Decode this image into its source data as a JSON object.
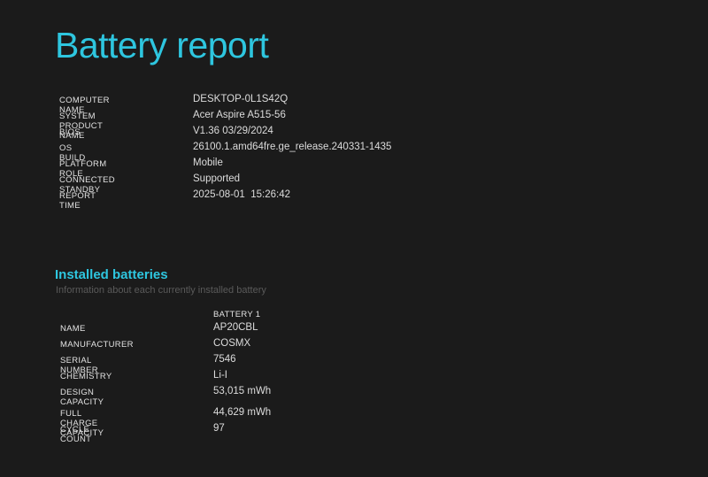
{
  "report": {
    "title": "Battery report"
  },
  "system_info": [
    {
      "label": "COMPUTER NAME",
      "value": "DESKTOP-0L1S42Q"
    },
    {
      "label": "SYSTEM PRODUCT NAME",
      "value": "Acer Aspire A515-56"
    },
    {
      "label": "BIOS",
      "value": "V1.36 03/29/2024"
    },
    {
      "label": "OS BUILD",
      "value": "26100.1.amd64fre.ge_release.240331-1435"
    },
    {
      "label": "PLATFORM ROLE",
      "value": "Mobile"
    },
    {
      "label": "CONNECTED STANDBY",
      "value": "Supported"
    },
    {
      "label": "REPORT TIME",
      "value": "2025-08-01  15:26:42"
    }
  ],
  "installed_batteries": {
    "title": "Installed batteries",
    "subtitle": "Information about each currently installed battery",
    "column_header": "BATTERY 1",
    "rows": [
      {
        "label": "NAME",
        "value": "AP20CBL"
      },
      {
        "label": "MANUFACTURER",
        "value": "COSMX"
      },
      {
        "label": "SERIAL NUMBER",
        "value": "7546"
      },
      {
        "label": "CHEMISTRY",
        "value": "Li-I"
      },
      {
        "label": "DESIGN CAPACITY",
        "value": "53,015 mWh"
      },
      {
        "label": "FULL CHARGE CAPACITY",
        "value": "44,629 mWh"
      },
      {
        "label": "CYCLE COUNT",
        "value": "97"
      }
    ]
  },
  "colors": {
    "background": "#1b1b1b",
    "accent": "#2ec6df",
    "text": "#dcdcdc",
    "muted": "#5a5a5a"
  }
}
